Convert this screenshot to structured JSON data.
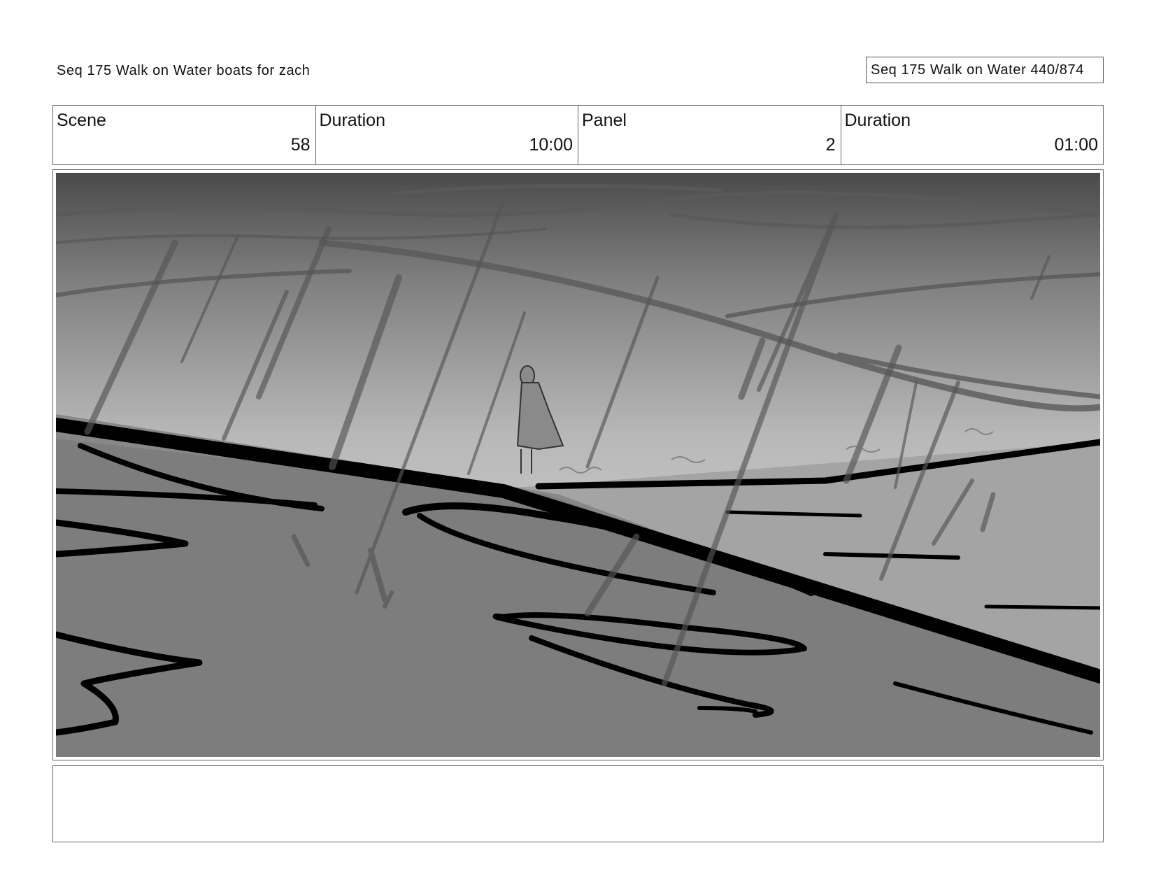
{
  "header": {
    "title_left": "Seq 175 Walk on Water  boats for zach",
    "title_right": "Seq 175 Walk on Water 440/874"
  },
  "info": [
    {
      "label": "Scene",
      "value": "58"
    },
    {
      "label": "Duration",
      "value": "10:00"
    },
    {
      "label": "Panel",
      "value": "2"
    },
    {
      "label": "Duration",
      "value": "01:00"
    }
  ],
  "notes": {
    "text": ""
  }
}
